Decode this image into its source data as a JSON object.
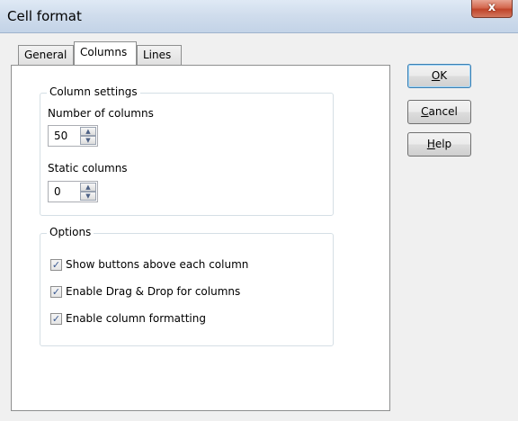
{
  "window": {
    "title": "Cell format",
    "close_glyph": "x"
  },
  "tabs": [
    {
      "label": "General",
      "active": false
    },
    {
      "label": "Columns",
      "active": true
    },
    {
      "label": "Lines",
      "active": false
    }
  ],
  "column_settings": {
    "legend": "Column settings",
    "number_label": "Number of columns",
    "number_value": "50",
    "static_label": "Static columns",
    "static_value": "0"
  },
  "options": {
    "legend": "Options",
    "items": [
      {
        "label": "Show buttons above each column",
        "checked": true
      },
      {
        "label": "Enable Drag & Drop for columns",
        "checked": true
      },
      {
        "label": "Enable column formatting",
        "checked": true
      }
    ]
  },
  "buttons": {
    "ok": {
      "mnemonic": "O",
      "rest": "K"
    },
    "cancel": {
      "mnemonic": "C",
      "rest": "ancel"
    },
    "help": {
      "mnemonic": "H",
      "rest": "elp"
    }
  },
  "icons": {
    "spin_up": "up-arrow",
    "spin_down": "down-arrow",
    "check": "checkmark"
  }
}
